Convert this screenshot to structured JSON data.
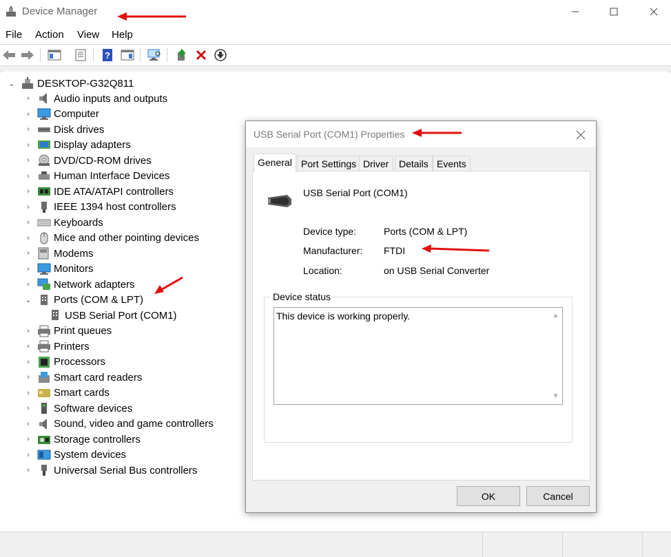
{
  "window": {
    "title": "Device Manager"
  },
  "menu": {
    "items": [
      "File",
      "Action",
      "View",
      "Help"
    ]
  },
  "toolbar": {
    "buttons": [
      "back-icon",
      "forward-icon",
      "show-hide-console-tree-icon",
      "properties-icon",
      "help-icon",
      "action-pane-icon",
      "scan-hardware-icon",
      "update-driver-icon",
      "uninstall-icon",
      "disable-device-icon"
    ]
  },
  "tree": {
    "root": "DESKTOP-G32Q811",
    "categories": [
      {
        "label": "Audio inputs and outputs",
        "icon": "speaker-icon"
      },
      {
        "label": "Computer",
        "icon": "monitor-icon"
      },
      {
        "label": "Disk drives",
        "icon": "disk-drive-icon"
      },
      {
        "label": "Display adapters",
        "icon": "display-adapter-icon"
      },
      {
        "label": "DVD/CD-ROM drives",
        "icon": "dvd-drive-icon"
      },
      {
        "label": "Human Interface Devices",
        "icon": "hid-icon"
      },
      {
        "label": "IDE ATA/ATAPI controllers",
        "icon": "ide-controller-icon"
      },
      {
        "label": "IEEE 1394 host controllers",
        "icon": "ieee1394-icon"
      },
      {
        "label": "Keyboards",
        "icon": "keyboard-icon"
      },
      {
        "label": "Mice and other pointing devices",
        "icon": "mouse-icon"
      },
      {
        "label": "Modems",
        "icon": "modem-icon"
      },
      {
        "label": "Monitors",
        "icon": "monitor-icon"
      },
      {
        "label": "Network adapters",
        "icon": "network-adapter-icon"
      },
      {
        "label": "Ports (COM & LPT)",
        "icon": "port-icon",
        "expanded": true
      },
      {
        "label": "USB Serial Port (COM1)",
        "icon": "port-icon",
        "child": true
      },
      {
        "label": "Print queues",
        "icon": "printer-icon"
      },
      {
        "label": "Printers",
        "icon": "printer-icon"
      },
      {
        "label": "Processors",
        "icon": "processor-icon"
      },
      {
        "label": "Smart card readers",
        "icon": "smart-card-reader-icon"
      },
      {
        "label": "Smart cards",
        "icon": "smart-card-icon"
      },
      {
        "label": "Software devices",
        "icon": "software-device-icon"
      },
      {
        "label": "Sound, video and game controllers",
        "icon": "speaker-icon"
      },
      {
        "label": "Storage controllers",
        "icon": "storage-controller-icon"
      },
      {
        "label": "System devices",
        "icon": "system-device-icon"
      },
      {
        "label": "Universal Serial Bus controllers",
        "icon": "usb-icon"
      }
    ]
  },
  "dialog": {
    "title": "USB Serial Port (COM1) Properties",
    "tabs": [
      "General",
      "Port Settings",
      "Driver",
      "Details",
      "Events"
    ],
    "active_tab": "General",
    "device_name": "USB Serial Port (COM1)",
    "device_type_label": "Device type:",
    "device_type_value": "Ports (COM & LPT)",
    "manufacturer_label": "Manufacturer:",
    "manufacturer_value": "FTDI",
    "location_label": "Location:",
    "location_value": "on USB Serial Converter",
    "status_legend": "Device status",
    "status_text": "This device is working properly.",
    "ok_label": "OK",
    "cancel_label": "Cancel"
  },
  "colors": {
    "annotation": "#e01010",
    "accent": "#1e7ad6"
  }
}
